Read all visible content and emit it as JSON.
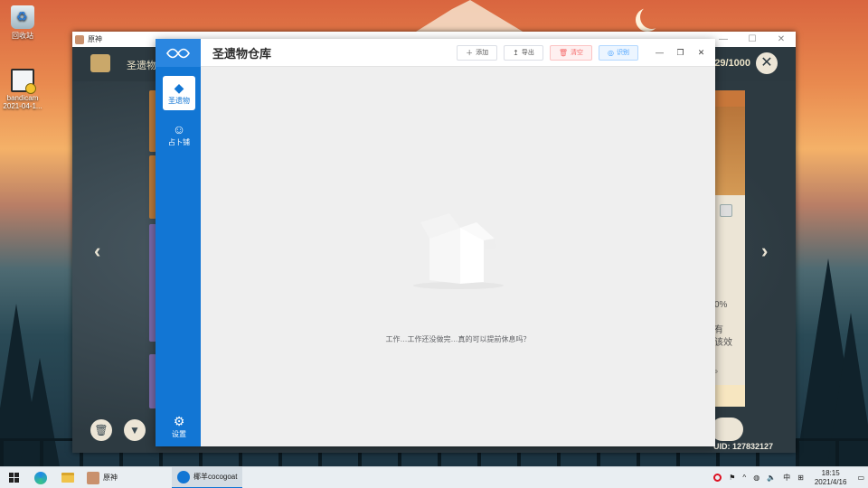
{
  "desktop": {
    "icons": [
      {
        "label": "回收站"
      },
      {
        "label": "bandicam",
        "sub": "2021-04-1..."
      }
    ]
  },
  "game": {
    "window_title": "原神",
    "category": "圣遗物",
    "count": "29/1000",
    "detail_lines": [
      "0%",
      "有",
      "该效",
      "。"
    ],
    "uid": "UID: 127832127"
  },
  "app": {
    "title": "圣遗物仓库",
    "nav": [
      {
        "label": "圣遗物",
        "icon": "artifact-icon"
      },
      {
        "label": "占卜铺",
        "icon": "fortune-icon"
      }
    ],
    "settings_label": "设置",
    "toolbar": {
      "add": "添加",
      "export": "导出",
      "clear": "清空",
      "scan": "识别"
    },
    "empty_text": "工作…工作还没做完…真的可以提前休息吗？"
  },
  "taskbar": {
    "tasks": [
      {
        "label": "原神"
      },
      {
        "label": "椰羊cocogoat"
      }
    ],
    "ime": "中",
    "time": "18:15",
    "date": "2021/4/16"
  },
  "colors": {
    "primary": "#1276d4",
    "danger": "#f56c6c",
    "info": "#409eff"
  }
}
